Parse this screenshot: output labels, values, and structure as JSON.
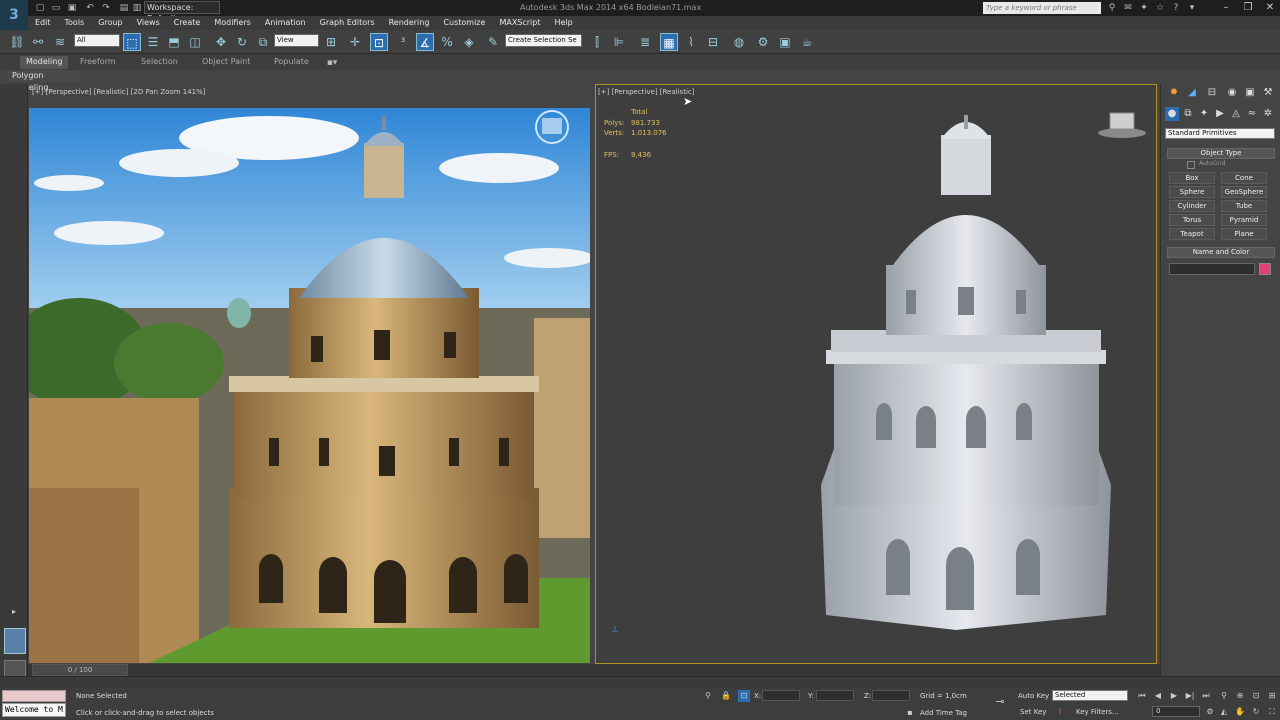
{
  "titlebar": {
    "workspace": "Workspace: Default",
    "title": "Autodesk 3ds Max 2014 x64     Bodleian71.max",
    "search_placeholder": "Type a keyword or phrase"
  },
  "menu": [
    "Edit",
    "Tools",
    "Group",
    "Views",
    "Create",
    "Modifiers",
    "Animation",
    "Graph Editors",
    "Rendering",
    "Customize",
    "MAXScript",
    "Help"
  ],
  "toolbar": {
    "filter": "All",
    "refcoord": "View",
    "selection_set": "Create Selection Se"
  },
  "ribbon": {
    "tabs": [
      "Modeling",
      "Freeform",
      "Selection",
      "Object Paint",
      "Populate"
    ],
    "panel_label": "Polygon Modeling"
  },
  "viewport_left": {
    "label": "[+] [Perspective] [Realistic] [2D Pan Zoom 141%]"
  },
  "viewport_right": {
    "label": "[+] [Perspective] [Realistic]",
    "stats": {
      "total_label": "Total",
      "polys_label": "Polys:",
      "polys": "981.733",
      "verts_label": "Verts:",
      "verts": "1.013.076",
      "fps_label": "FPS:",
      "fps": "9,436"
    }
  },
  "command_panel": {
    "category": "Standard Primitives",
    "object_type_title": "Object Type",
    "autogrid": "AutoGrid",
    "buttons": [
      "Box",
      "Cone",
      "Sphere",
      "GeoSphere",
      "Cylinder",
      "Tube",
      "Torus",
      "Pyramid",
      "Teapot",
      "Plane"
    ],
    "name_color_title": "Name and Color",
    "color": "#e0407a"
  },
  "timeline": {
    "slider": "0 / 100"
  },
  "status": {
    "maxscript": "Welcome to M",
    "selection": "None Selected",
    "prompt": "Click or click-and-drag to select objects",
    "x": "X:",
    "y": "Y:",
    "z": "Z:",
    "grid": "Grid = 1,0cm",
    "add_time_tag": "Add Time Tag",
    "auto_key": "Auto Key",
    "set_key": "Set Key",
    "key_mode": "Selected",
    "key_filters": "Key Filters...",
    "frame": "0"
  }
}
